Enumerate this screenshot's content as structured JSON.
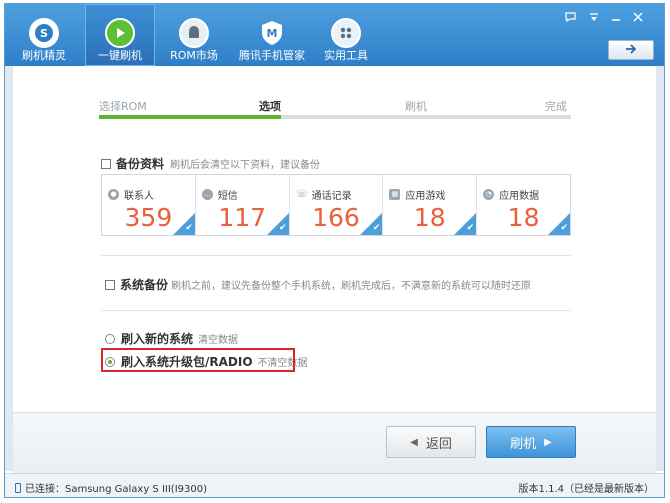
{
  "nav": {
    "items": [
      {
        "label": "刷机精灵"
      },
      {
        "label": "一键刷机"
      },
      {
        "label": "ROM市场"
      },
      {
        "label": "腾讯手机管家"
      },
      {
        "label": "实用工具"
      }
    ]
  },
  "steps": {
    "items": [
      "选择ROM",
      "选项",
      "刷机",
      "完成"
    ],
    "current": "选项",
    "progress_fraction": 0.385
  },
  "backup": {
    "title": "备份资料",
    "hint": "刷机后会清空以下资料，建议备份",
    "cards": [
      {
        "label": "联系人",
        "count": "359"
      },
      {
        "label": "短信",
        "count": "117"
      },
      {
        "label": "通话记录",
        "count": "166"
      },
      {
        "label": "应用游戏",
        "count": "18"
      },
      {
        "label": "应用数据",
        "count": "18"
      }
    ]
  },
  "system_backup": {
    "title": "系统备份",
    "hint": "刷机之前，建议先备份整个手机系统，刷机完成后，不满意新的系统可以随时还原"
  },
  "flash_options": [
    {
      "label": "刷入新的系统",
      "hint": "清空数据",
      "selected": false
    },
    {
      "label": "刷入系统升级包/RADIO",
      "hint": "不清空数据",
      "selected": true
    }
  ],
  "buttons": {
    "back": "返回",
    "flash": "刷机"
  },
  "status": {
    "connected": "已连接：Samsung Galaxy S III(I9300)",
    "version": "版本1.1.4（已经是最新版本）"
  },
  "colors": {
    "header": "#2f7fc8",
    "accent_green": "#5cb433",
    "count_orange": "#e8603c",
    "highlight_red": "#d9262b"
  }
}
